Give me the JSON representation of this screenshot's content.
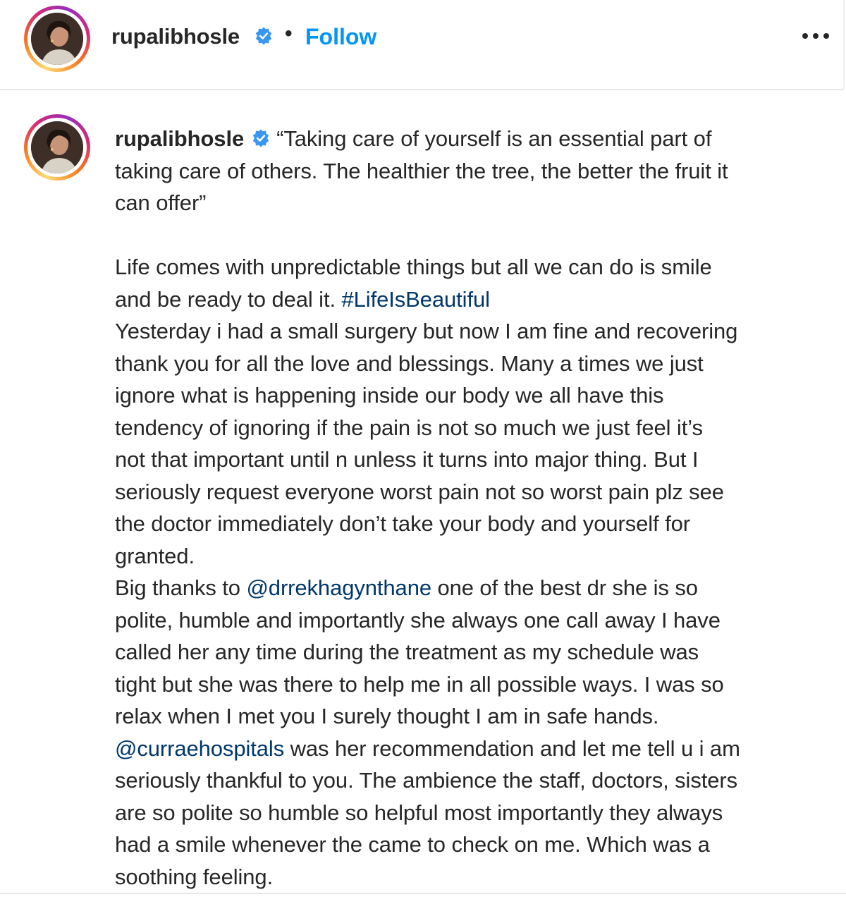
{
  "header": {
    "username": "rupalibhosle",
    "separator": "•",
    "follow_label": "Follow",
    "verified_icon": "verified-badge-icon",
    "more_icon": "more-options-icon"
  },
  "post": {
    "username": "rupalibhosle",
    "caption_lines": [
      "“Taking care of yourself is an essential part of",
      "taking care of others. The healthier the tree, the better the fruit it",
      "can offer”",
      "",
      "Life comes with unpredictable things but all we can do is smile",
      "and be ready to deal it. ",
      "Yesterday i had a small surgery but now I am fine and recovering",
      "thank you for all the love and blessings. Many a times we just",
      "ignore what is happening inside our body we all have this",
      "tendency of ignoring if the pain is not so much we just feel it’s",
      "not that important until n unless it turns into major thing. But I",
      "seriously request everyone worst pain not so worst pain plz see",
      "the doctor immediately don’t take your body and yourself for",
      "granted.",
      "Big thanks to ",
      " one of the best dr she is so",
      "polite, humble and importantly she always one call away I have",
      "called her any time during the treatment as my schedule was",
      "tight but she was there to help me in all possible ways. I was so",
      "relax when I met you I surely thought I am in safe hands.",
      " was her recommendation and let me tell u i am",
      "seriously thankful to you. The ambience the staff, doctors, sisters",
      "are so polite so humble so helpful most importantly they always",
      "had a smile whenever the came to check on me. Which was a",
      "soothing feeling."
    ],
    "hashtag": "#LifeIsBeautiful",
    "mention_doctor": "@drrekhagynthane",
    "mention_hospital": "@curraehospitals"
  },
  "colors": {
    "text": "#262626",
    "follow": "#0095f6",
    "link": "#00376b",
    "verified": "#3897f0"
  }
}
